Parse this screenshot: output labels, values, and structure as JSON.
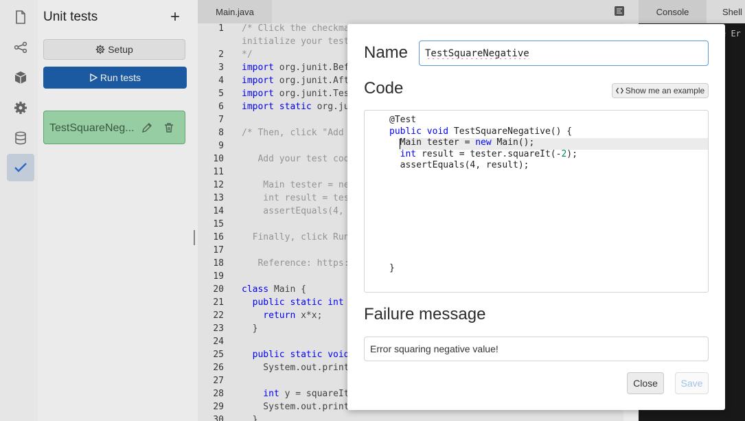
{
  "rail": {
    "icons": [
      "file-icon",
      "share-icon",
      "cube-icon",
      "gear-icon",
      "database-icon",
      "checkmark-icon"
    ]
  },
  "panel": {
    "title": "Unit tests",
    "add_symbol": "+",
    "setup_label": "Setup",
    "run_label": "Run tests",
    "test_item": "TestSquareNeg..."
  },
  "editor": {
    "tab": "Main.java",
    "lines": [
      {
        "n": "1",
        "t": "/* Click the checkma",
        "cls": "cm"
      },
      {
        "n": "",
        "t": "initialize your test",
        "cls": "cm"
      },
      {
        "n": "2",
        "t": "*/",
        "cls": "cm"
      },
      {
        "n": "3",
        "k": "import",
        "t": " org.junit.Bef"
      },
      {
        "n": "4",
        "k": "import",
        "t": " org.junit.Aft"
      },
      {
        "n": "5",
        "k": "import",
        "t": " org.junit.Tes"
      },
      {
        "n": "6",
        "k": "import static",
        "t": " org.ju"
      },
      {
        "n": "7",
        "t": ""
      },
      {
        "n": "8",
        "t": "/* Then, click \"Add",
        "cls": "cm"
      },
      {
        "n": "9",
        "t": ""
      },
      {
        "n": "10",
        "t": "   Add your test cod",
        "cls": "cm"
      },
      {
        "n": "11",
        "t": ""
      },
      {
        "n": "12",
        "t": "    Main tester = ne",
        "cls": "cm"
      },
      {
        "n": "13",
        "t": "    int result = tes",
        "cls": "cm"
      },
      {
        "n": "14",
        "t": "    assertEquals(4,",
        "cls": "cm"
      },
      {
        "n": "15",
        "t": ""
      },
      {
        "n": "16",
        "t": "  Finally, click Run",
        "cls": "cm"
      },
      {
        "n": "17",
        "t": ""
      },
      {
        "n": "18",
        "t": "   Reference: https:",
        "cls": "cm"
      },
      {
        "n": "19",
        "t": ""
      },
      {
        "n": "20",
        "k": "class",
        "t": " Main {"
      },
      {
        "n": "21",
        "k": "  public static int",
        "t": ""
      },
      {
        "n": "22",
        "k": "    return",
        "t": " x*x;"
      },
      {
        "n": "23",
        "t": "  }"
      },
      {
        "n": "24",
        "t": ""
      },
      {
        "n": "25",
        "k": "  public static void",
        "t": ""
      },
      {
        "n": "26",
        "t": "    System.out.print"
      },
      {
        "n": "27",
        "t": ""
      },
      {
        "n": "28",
        "k": "    int",
        "t": " y = squareIt"
      },
      {
        "n": "29",
        "t": "    System.out.print"
      },
      {
        "n": "30",
        "t": "  }"
      }
    ]
  },
  "right_pane": {
    "tabs": [
      "Console",
      "Shell"
    ],
    "console_text": "e Er"
  },
  "modal": {
    "name_label": "Name",
    "name_value": "TestSquareNegative",
    "code_label": "Code",
    "example_label": "Show me an example",
    "code_lines": [
      {
        "i": "",
        "parts": [
          {
            "t": "@Test"
          }
        ]
      },
      {
        "i": "",
        "parts": [
          {
            "t": "public void",
            "c": "kw"
          },
          {
            "t": " TestSquareNegative() {"
          }
        ]
      },
      {
        "i": "  ",
        "parts": [
          {
            "t": "Main tester = "
          },
          {
            "t": "new",
            "c": "kw"
          },
          {
            "t": " Main();"
          }
        ]
      },
      {
        "i": "  ",
        "parts": [
          {
            "t": "int",
            "c": "kw"
          },
          {
            "t": " result = tester.squareIt(-"
          },
          {
            "t": "2",
            "c": "num"
          },
          {
            "t": ");"
          }
        ]
      },
      {
        "i": "  ",
        "parts": [
          {
            "t": "assertEquals(4, result);"
          }
        ]
      },
      {
        "i": "",
        "parts": [
          {
            "t": ""
          }
        ]
      },
      {
        "i": "",
        "parts": [
          {
            "t": ""
          }
        ]
      },
      {
        "i": "",
        "parts": [
          {
            "t": ""
          }
        ]
      },
      {
        "i": "",
        "parts": [
          {
            "t": ""
          }
        ]
      },
      {
        "i": "",
        "parts": [
          {
            "t": ""
          }
        ]
      },
      {
        "i": "",
        "parts": [
          {
            "t": ""
          }
        ]
      },
      {
        "i": "",
        "parts": [
          {
            "t": ""
          }
        ]
      },
      {
        "i": "",
        "parts": [
          {
            "t": ""
          }
        ]
      },
      {
        "i": "",
        "parts": [
          {
            "t": "}"
          }
        ]
      }
    ],
    "failure_label": "Failure message",
    "failure_value": "Error squaring negative value!",
    "close_label": "Close",
    "save_label": "Save"
  },
  "colors": {
    "keyword": "#0000ff",
    "comment": "#9a9a9a",
    "number": "#098658",
    "run_button": "#1d5ea8",
    "test_item_bg": "#8fd19e"
  }
}
